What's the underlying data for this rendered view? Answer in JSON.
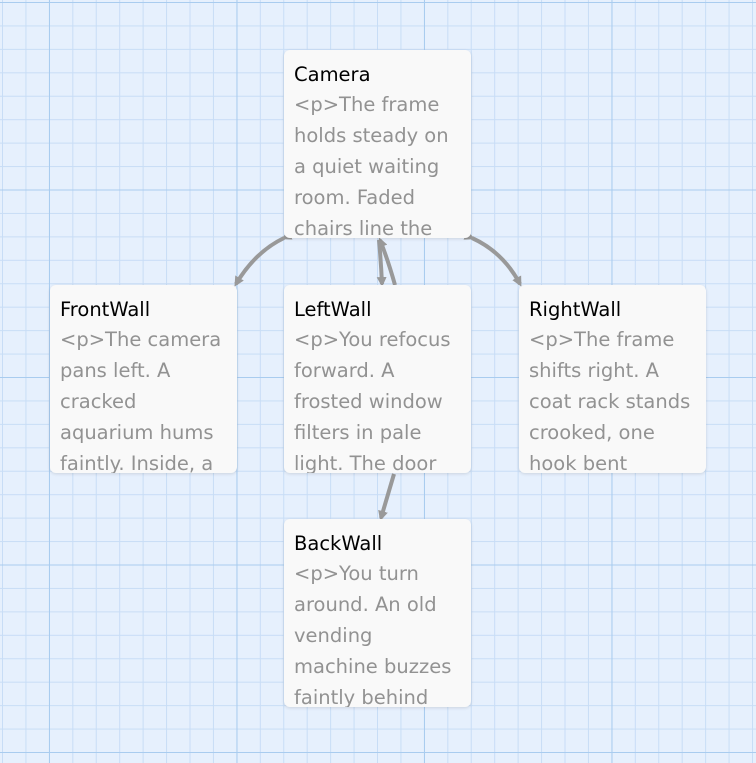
{
  "passages": [
    {
      "id": "camera",
      "title": "Camera",
      "excerpt": "<p>The frame holds steady on a quiet waiting room. Faded chairs line the walls."
    },
    {
      "id": "front",
      "title": "FrontWall",
      "excerpt": "<p>The camera pans left. A cracked aquarium hums faintly. Inside, a lone fish drifts."
    },
    {
      "id": "left",
      "title": "LeftWall",
      "excerpt": "<p>You refocus forward. A frosted window filters in pale light. The door beside it is shut."
    },
    {
      "id": "right",
      "title": "RightWall",
      "excerpt": "<p>The frame shifts right. A coat rack stands crooked, one hook bent downward."
    },
    {
      "id": "back",
      "title": "BackWall",
      "excerpt": "<p>You turn around. An old vending machine buzzes faintly behind the glass."
    }
  ],
  "colors": {
    "arrow": "#999999",
    "grid_major": "#a9ccef",
    "grid_minor": "#c8ddf6",
    "background": "#e6f0fd"
  }
}
